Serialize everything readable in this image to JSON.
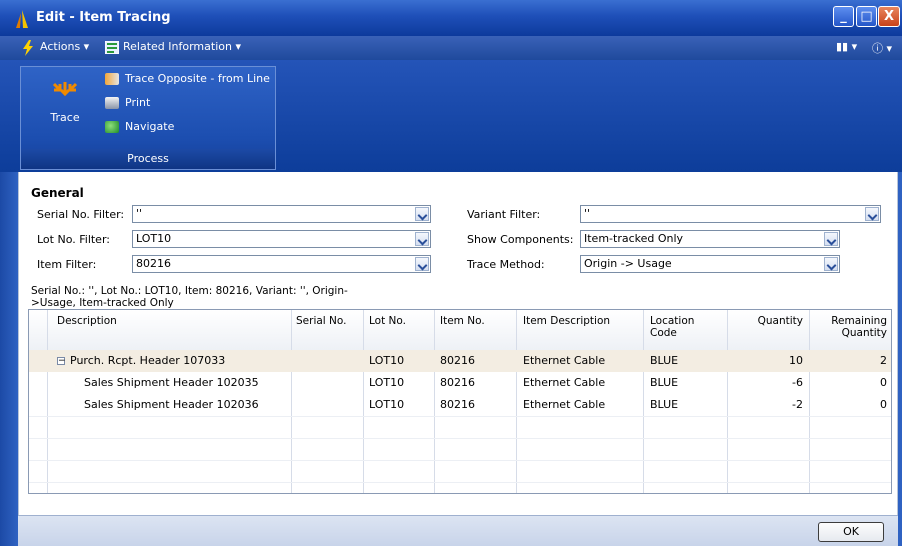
{
  "window": {
    "title": "Edit - Item Tracing",
    "minimize": "_",
    "maximize": "□",
    "close": "X"
  },
  "menubar": {
    "actions": "Actions",
    "related": "Related Information"
  },
  "ribbon": {
    "trace": "Trace",
    "trace_opposite": "Trace Opposite - from Line",
    "print": "Print",
    "navigate": "Navigate",
    "group": "Process"
  },
  "general": {
    "heading": "General",
    "serial_label": "Serial No. Filter:",
    "serial_value": "''",
    "lot_label": "Lot No. Filter:",
    "lot_value": "LOT10",
    "item_label": "Item Filter:",
    "item_value": "80216",
    "variant_label": "Variant Filter:",
    "variant_value": "''",
    "components_label": "Show Components:",
    "components_value": "Item-tracked Only",
    "method_label": "Trace Method:",
    "method_value": "Origin -> Usage"
  },
  "summary": "Serial No.: '', Lot No.: LOT10, Item: 80216, Variant: '', Origin->Usage, Item-tracked Only",
  "grid": {
    "headers": {
      "description": "Description",
      "serial": "Serial No.",
      "lot": "Lot No.",
      "item": "Item No.",
      "item_desc": "Item Description",
      "location": "Location Code",
      "quantity": "Quantity",
      "remaining": "Remaining Quantity"
    },
    "rows": [
      {
        "description": "Purch. Rcpt. Header 107033",
        "serial": "",
        "lot": "LOT10",
        "item": "80216",
        "item_desc": "Ethernet Cable",
        "location": "BLUE",
        "quantity": "10",
        "remaining": "2"
      },
      {
        "description": "Sales Shipment Header 102035",
        "serial": "",
        "lot": "LOT10",
        "item": "80216",
        "item_desc": "Ethernet Cable",
        "location": "BLUE",
        "quantity": "-6",
        "remaining": "0"
      },
      {
        "description": "Sales Shipment Header 102036",
        "serial": "",
        "lot": "LOT10",
        "item": "80216",
        "item_desc": "Ethernet Cable",
        "location": "BLUE",
        "quantity": "-2",
        "remaining": "0"
      }
    ]
  },
  "buttons": {
    "ok": "OK"
  }
}
